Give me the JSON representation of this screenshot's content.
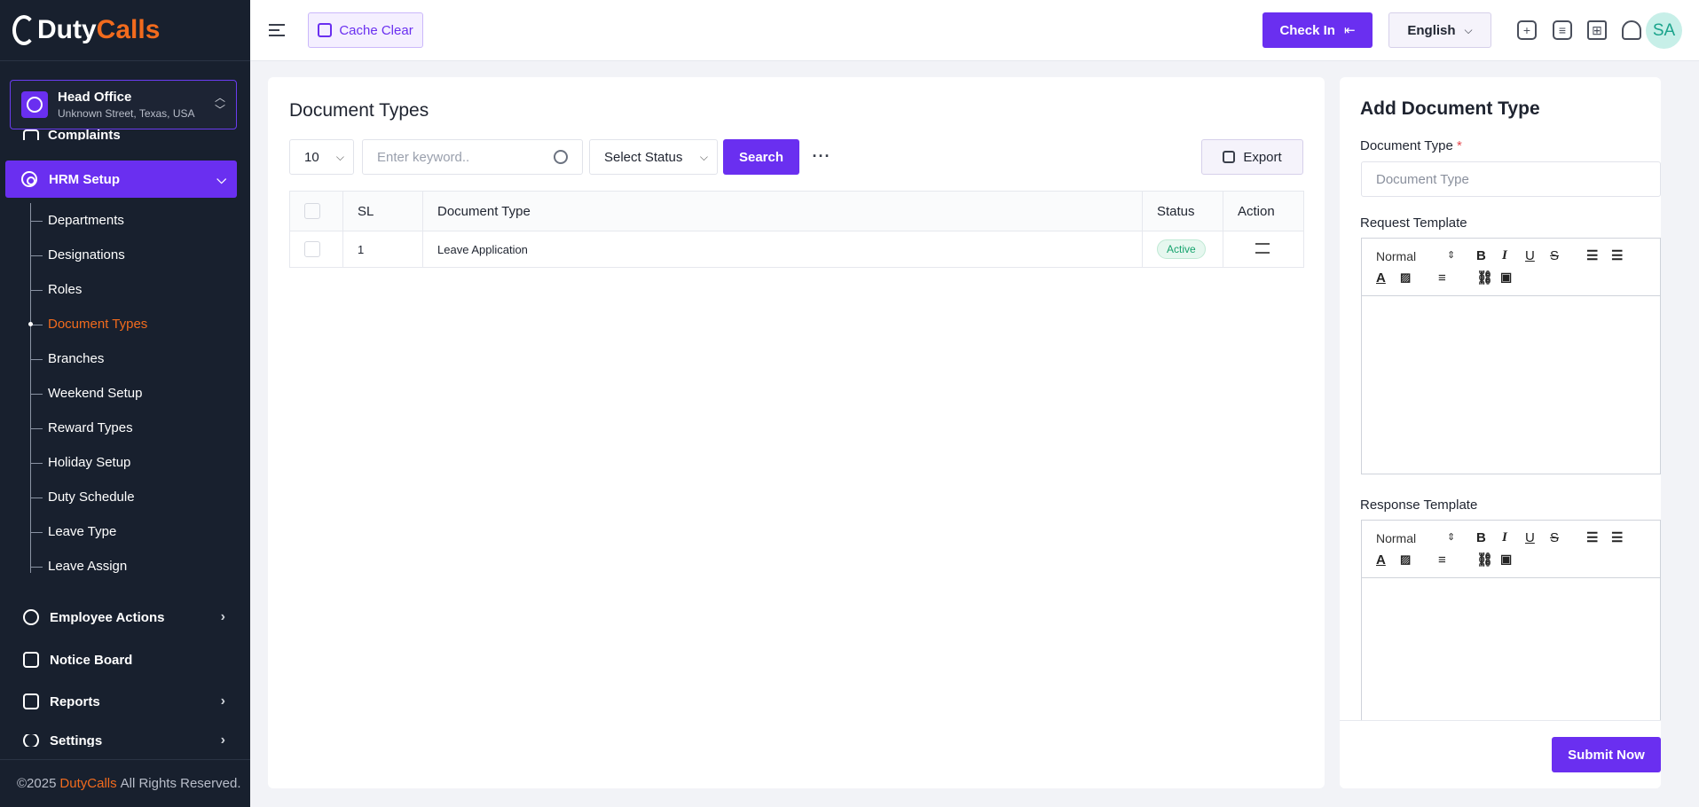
{
  "brand": {
    "part1": "Duty",
    "part2": "Calls"
  },
  "branch": {
    "title": "Head Office",
    "address": "Unknown Street, Texas, USA"
  },
  "sidebar": {
    "partial_item": "Complaints",
    "active_group": "HRM Setup",
    "submenu": [
      {
        "label": "Departments",
        "active": false
      },
      {
        "label": "Designations",
        "active": false
      },
      {
        "label": "Roles",
        "active": false
      },
      {
        "label": "Document Types",
        "active": true
      },
      {
        "label": "Branches",
        "active": false
      },
      {
        "label": "Weekend Setup",
        "active": false
      },
      {
        "label": "Reward Types",
        "active": false
      },
      {
        "label": "Holiday Setup",
        "active": false
      },
      {
        "label": "Duty Schedule",
        "active": false
      },
      {
        "label": "Leave Type",
        "active": false
      },
      {
        "label": "Leave Assign",
        "active": false
      }
    ],
    "links": [
      {
        "label": "Employee Actions",
        "has_arrow": true
      },
      {
        "label": "Notice Board",
        "has_arrow": false
      },
      {
        "label": "Reports",
        "has_arrow": true
      },
      {
        "label": "Settings",
        "has_arrow": true
      }
    ],
    "footer": {
      "prefix": "©2025",
      "brand": "DutyCalls",
      "suffix": "All Rights Reserved."
    }
  },
  "topbar": {
    "cache_label": "Cache Clear",
    "checkin_label": "Check In",
    "language": "English",
    "avatar_initials": "SA",
    "icons": [
      "plus-square-icon",
      "chat-icon",
      "apps-grid-icon",
      "bell-icon"
    ]
  },
  "main": {
    "title": "Document Types",
    "page_size": "10",
    "search_placeholder": "Enter keyword..",
    "status_placeholder": "Select Status",
    "search_label": "Search",
    "more_label": "···",
    "export_label": "Export",
    "columns": [
      "SL",
      "Document Type",
      "Status",
      "Action"
    ],
    "rows": [
      {
        "sl": "1",
        "document_type": "Leave Application",
        "status": "Active"
      }
    ]
  },
  "form": {
    "title": "Add Document Type",
    "doc_type_label": "Document Type",
    "doc_type_required": "*",
    "doc_type_placeholder": "Document Type",
    "request_label": "Request Template",
    "response_label": "Response Template",
    "editor_format": "Normal",
    "submit_label": "Submit Now"
  },
  "colors": {
    "accent": "#6a2ff0",
    "brand_orange": "#f26b1d",
    "sidebar_bg": "#18202e",
    "active_badge": "#16a36d"
  }
}
